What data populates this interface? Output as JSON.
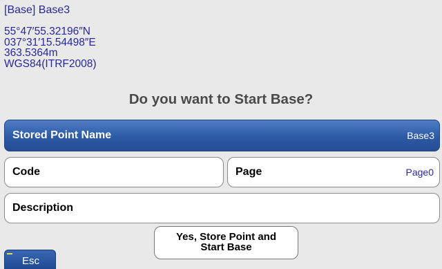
{
  "header": {
    "base_title": "[Base] Base3",
    "latitude": "55°47′55.32196″N",
    "longitude": "037°31′15.54498″E",
    "height": "363.5364m",
    "datum": "WGS84(ITRF2008)"
  },
  "question": "Do you want to Start Base?",
  "stored_point": {
    "label": "Stored Point Name",
    "value": "Base3"
  },
  "code": {
    "label": "Code",
    "value": ""
  },
  "page": {
    "label": "Page",
    "value": "Page0"
  },
  "description": {
    "label": "Description",
    "value": ""
  },
  "buttons": {
    "store_line1": "Yes, Store Point and",
    "store_line2": "Start Base",
    "esc": "Esc"
  },
  "colors": {
    "background": "#e9e9e9",
    "info_text": "#2727a0",
    "accent_blue": "#2d5aa4"
  }
}
